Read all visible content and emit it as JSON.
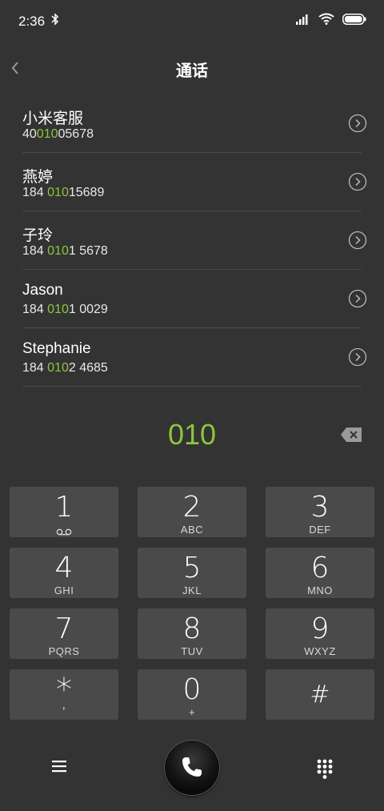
{
  "status_bar": {
    "time": "2:36"
  },
  "header": {
    "title": "通话"
  },
  "contacts": [
    {
      "name": "小米客服",
      "number_pre": "40",
      "number_match": "010",
      "number_post": "05678"
    },
    {
      "name": "燕婷",
      "number_pre": "184 ",
      "number_match": "010",
      "number_post": "15689"
    },
    {
      "name": "子玲",
      "number_pre": "184 ",
      "number_match": "010",
      "number_post": "1 5678"
    },
    {
      "name": "Jason",
      "number_pre": "184 ",
      "number_match": "010",
      "number_post": "1 0029"
    },
    {
      "name": "Stephanie",
      "number_pre": "184 ",
      "number_match": "010",
      "number_post": "2 4685"
    }
  ],
  "dialed": "010",
  "keypad": [
    {
      "digit": "1",
      "letters": ""
    },
    {
      "digit": "2",
      "letters": "ABC"
    },
    {
      "digit": "3",
      "letters": "DEF"
    },
    {
      "digit": "4",
      "letters": "GHI"
    },
    {
      "digit": "5",
      "letters": "JKL"
    },
    {
      "digit": "6",
      "letters": "MNO"
    },
    {
      "digit": "7",
      "letters": "PQRS"
    },
    {
      "digit": "8",
      "letters": "TUV"
    },
    {
      "digit": "9",
      "letters": "WXYZ"
    },
    {
      "digit": "*",
      "letters": ","
    },
    {
      "digit": "0",
      "letters": "+"
    },
    {
      "digit": "#",
      "letters": ""
    }
  ],
  "colors": {
    "background": "#333333",
    "key": "#4a4a4a",
    "highlight": "#8cc63f"
  }
}
